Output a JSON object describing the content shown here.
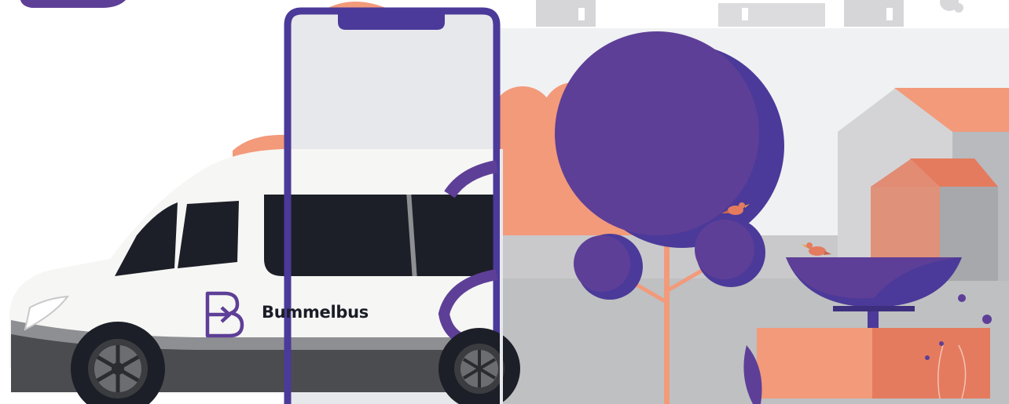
{
  "brand": {
    "name": "Bummelbus",
    "logo_icon": "bummelbus-b-arrow-logo-icon"
  },
  "colors": {
    "purple": "#5e3f97",
    "purple_dark": "#4b3a99",
    "coral": "#f29a7a",
    "coral_dark": "#e47b5f",
    "van_white": "#f6f6f4",
    "window_dark": "#1c1f27",
    "grey_light": "#e8e9ec",
    "grey_mid": "#cfcfd1",
    "grey_dark": "#a7a8ab"
  }
}
